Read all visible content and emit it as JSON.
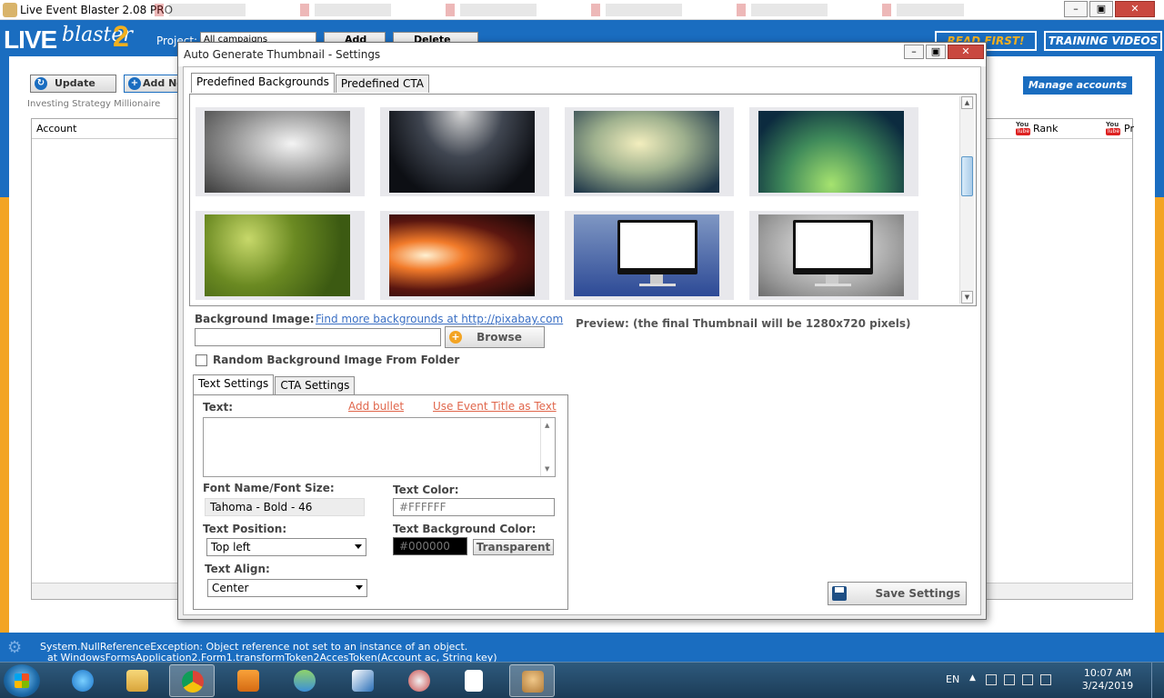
{
  "app": {
    "title": "Live Event Blaster 2.08 PRO",
    "logo": {
      "live": "LIVE",
      "blaster": "blaster",
      "num": "2"
    },
    "project_label": "Project:",
    "project_value": "All campaigns",
    "add_label": "Add",
    "delete_label": "Delete",
    "read_first": "READ FIRST!",
    "training": "TRAINING VIDEOS",
    "update": "Update",
    "add_new": "Add New",
    "group": "Investing Strategy Millionaire",
    "manage": "Manage accounts",
    "grid": {
      "account": "Account",
      "rank": "Rank",
      "pr": "Pr"
    },
    "yt_you": "You",
    "yt_tube": "Tube"
  },
  "error": {
    "line1": "System.NullReferenceException: Object reference not set to an instance of an object.",
    "line2": "at WindowsFormsApplication2.Form1.transformToken2AccesToken(Account ac, String key)"
  },
  "dialog": {
    "title": "Auto Generate Thumbnail - Settings",
    "tabs": [
      "Predefined Backgrounds",
      "Predefined CTA"
    ],
    "bg_label": "Background Image:",
    "bg_link": "Find more backgrounds at http://pixabay.com",
    "bg_value": "",
    "browse": "Browse",
    "random_label": "Random Background Image From Folder",
    "random_checked": false,
    "preview": "Preview: (the final Thumbnail will be 1280x720 pixels)",
    "text_tabs": [
      "Text Settings",
      "CTA Settings"
    ],
    "text_label": "Text:",
    "add_bullet": "Add bullet",
    "use_title": "Use Event Title as Text",
    "text_value": "",
    "font_label": "Font Name/Font Size:",
    "font_value": "Tahoma - Bold - 46",
    "color_label": "Text Color:",
    "color_value": "#FFFFFF",
    "position_label": "Text Position:",
    "position_value": "Top left",
    "bgcolor_label": "Text Background Color:",
    "bgcolor_value": "#000000",
    "transparent": "Transparent",
    "align_label": "Text Align:",
    "align_value": "Center",
    "save": "Save Settings"
  },
  "taskbar": {
    "lang": "EN",
    "time": "10:07 AM",
    "date": "3/24/2019"
  },
  "colors": {
    "brand_blue": "#1a6dc0",
    "brand_gold": "#f3a423",
    "link_blue": "#3a6fc4",
    "link_red": "#e0664b"
  },
  "icons": [
    "app-icon",
    "update-icon",
    "add-icon",
    "browse-plus-icon",
    "save-disk-icon",
    "youtube-icon",
    "start-icon",
    "ie-icon",
    "explorer-icon",
    "chrome-icon",
    "media-icon",
    "messenger-icon",
    "wifi-icon",
    "snip-icon",
    "file-icon",
    "app-taskbar-icon"
  ]
}
